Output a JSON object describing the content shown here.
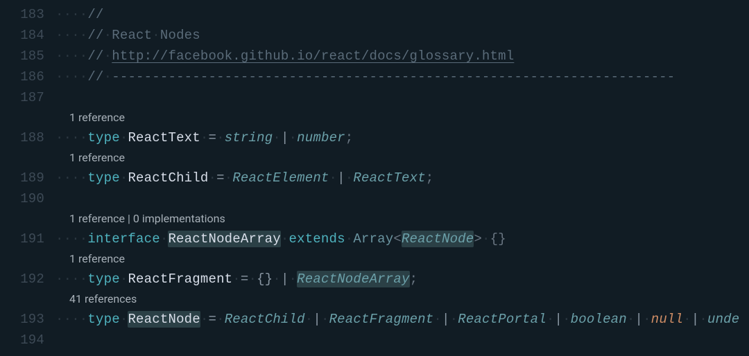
{
  "lines": {
    "l183": {
      "num": "183",
      "comment_slash": "//"
    },
    "l184": {
      "num": "184",
      "comment_slash": "//",
      "text": "React",
      "text2": "Nodes"
    },
    "l185": {
      "num": "185",
      "comment_slash": "//",
      "url": "http://facebook.github.io/react/docs/glossary.html"
    },
    "l186": {
      "num": "186",
      "comment_slash": "//",
      "dashes": "----------------------------------------------------------------------"
    },
    "l187": {
      "num": "187"
    },
    "l188": {
      "num": "188",
      "lens": "1 reference",
      "kw": "type",
      "name": "ReactText",
      "eq": "=",
      "t1": "string",
      "pipe": "|",
      "t2": "number",
      "semi": ";"
    },
    "l189": {
      "num": "189",
      "lens": "1 reference",
      "kw": "type",
      "name": "ReactChild",
      "eq": "=",
      "t1": "ReactElement",
      "pipe": "|",
      "t2": "ReactText",
      "semi": ";"
    },
    "l190": {
      "num": "190"
    },
    "l191": {
      "num": "191",
      "lens": "1 reference | 0 implementations",
      "kw": "interface",
      "name": "ReactNodeArray",
      "kw2": "extends",
      "base": "Array",
      "lt": "<",
      "param": "ReactNode",
      "gt": ">",
      "braces": "{}"
    },
    "l192": {
      "num": "192",
      "lens": "1 reference",
      "kw": "type",
      "name": "ReactFragment",
      "eq": "=",
      "t1": "{}",
      "pipe": "|",
      "t2": "ReactNodeArray",
      "semi": ";"
    },
    "l193": {
      "num": "193",
      "lens": "41 references",
      "kw": "type",
      "name": "ReactNode",
      "eq": "=",
      "t1": "ReactChild",
      "pipe": "|",
      "t2": "ReactFragment",
      "t3": "ReactPortal",
      "t4": "boolean",
      "t5": "null",
      "t6": "unde"
    },
    "l194": {
      "num": "194"
    }
  },
  "ws_dot": "·",
  "indent4": "····"
}
